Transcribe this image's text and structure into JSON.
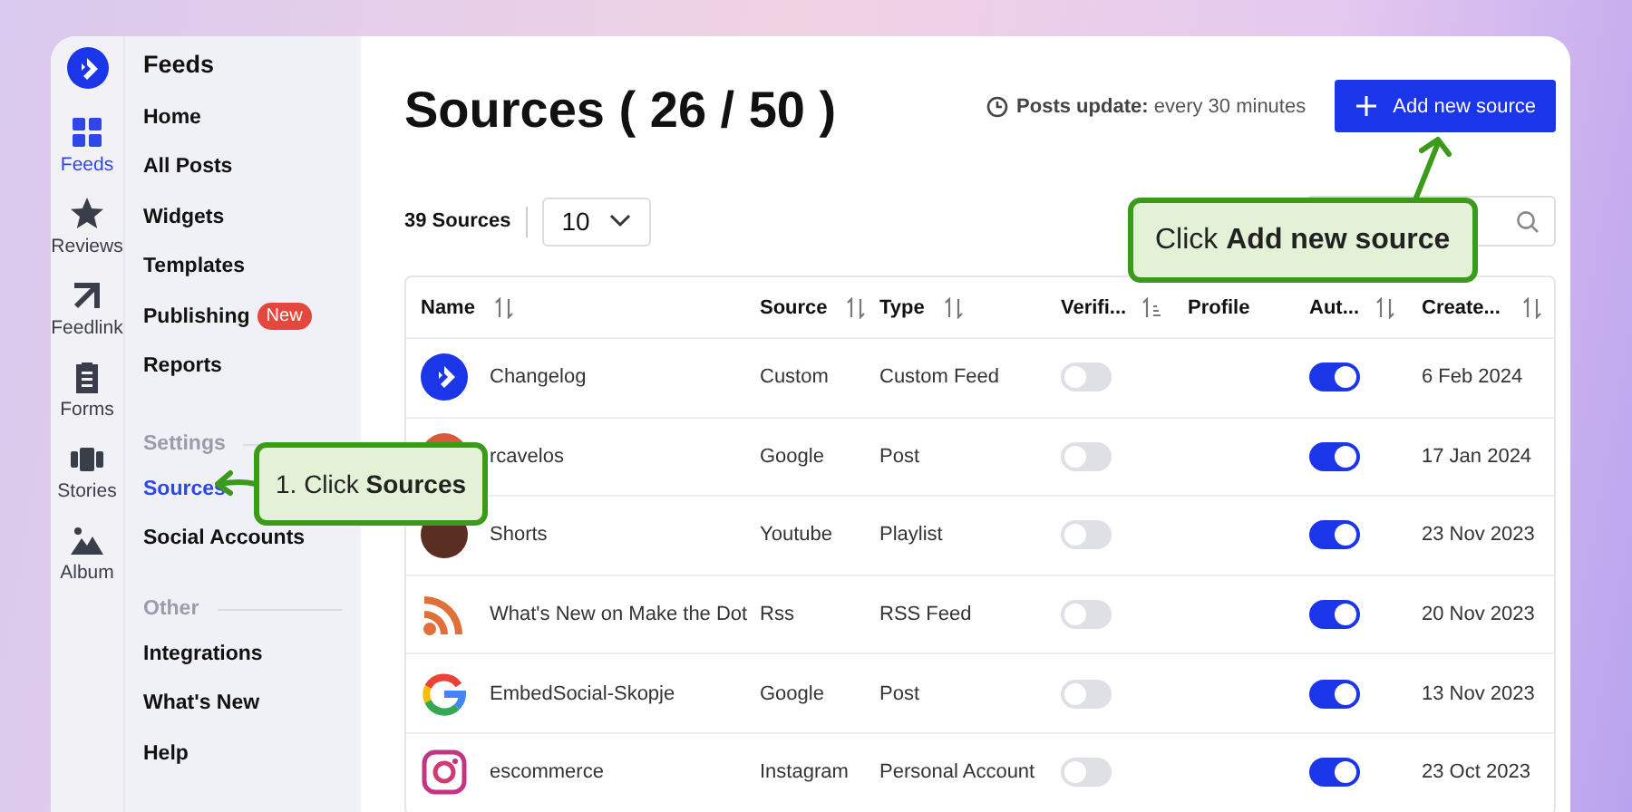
{
  "rail": [
    {
      "label": "Feeds",
      "kind": "grid",
      "selected": true
    },
    {
      "label": "Reviews",
      "kind": "star",
      "selected": false
    },
    {
      "label": "Feedlink",
      "kind": "arrow",
      "selected": false
    },
    {
      "label": "Forms",
      "kind": "clipboard",
      "selected": false
    },
    {
      "label": "Stories",
      "kind": "stories",
      "selected": false
    },
    {
      "label": "Album",
      "kind": "mountain",
      "selected": false
    }
  ],
  "sidebar": {
    "title": "Feeds",
    "sections": [
      {
        "items": [
          {
            "label": "Home",
            "selected": false
          },
          {
            "label": "All Posts",
            "selected": false
          },
          {
            "label": "Widgets",
            "selected": false
          },
          {
            "label": "Templates",
            "selected": false
          },
          {
            "label": "Publishing",
            "badge": "New",
            "selected": false
          },
          {
            "label": "Reports",
            "selected": false
          }
        ]
      },
      {
        "heading": "Settings",
        "items": [
          {
            "label": "Sources",
            "selected": true
          },
          {
            "label": "Social Accounts",
            "selected": false
          }
        ]
      },
      {
        "heading": "Other",
        "items": [
          {
            "label": "Integrations",
            "selected": false
          },
          {
            "label": "What's New",
            "selected": false
          },
          {
            "label": "Help",
            "selected": false
          }
        ]
      }
    ]
  },
  "page": {
    "title": "Sources ( 26 / 50 )",
    "update_label": "Posts update:",
    "update_value": "every 30 minutes",
    "add_button": "Add new source",
    "count": "39 Sources",
    "page_size": "10"
  },
  "table": {
    "columns": [
      {
        "label": "Name",
        "kind": "both"
      },
      {
        "label": "Source",
        "kind": "both"
      },
      {
        "label": "Type",
        "kind": "both"
      },
      {
        "label": "Verifi...",
        "kind": "asc"
      },
      {
        "label": "Profile",
        "kind": "none"
      },
      {
        "label": "Aut...",
        "kind": "both"
      },
      {
        "label": "Create...",
        "kind": "both"
      }
    ],
    "rows": [
      {
        "kind": "logo",
        "name": "Changelog",
        "source": "Custom",
        "type": "Custom Feed",
        "verified": false,
        "auto": true,
        "created": "6 Feb 2024"
      },
      {
        "kind": "photo-red",
        "name": "rcavelos",
        "source": "Google",
        "type": "Post",
        "verified": false,
        "auto": true,
        "created": "17 Jan 2024"
      },
      {
        "kind": "photo-dark",
        "name": "Shorts",
        "source": "Youtube",
        "type": "Playlist",
        "verified": false,
        "auto": true,
        "created": "23 Nov 2023"
      },
      {
        "kind": "rss",
        "name": "What's New on Make the Dot",
        "source": "Rss",
        "type": "RSS Feed",
        "verified": false,
        "auto": true,
        "created": "20 Nov 2023"
      },
      {
        "kind": "google",
        "name": "EmbedSocial-Skopje",
        "source": "Google",
        "type": "Post",
        "verified": false,
        "auto": true,
        "created": "13 Nov 2023"
      },
      {
        "kind": "instagram",
        "name": "escommerce",
        "source": "Instagram",
        "type": "Personal Account",
        "verified": false,
        "auto": true,
        "created": "23 Oct 2023"
      }
    ]
  },
  "callouts": [
    {
      "kind": "sidebar",
      "text": "1. Click **Sources**"
    },
    {
      "kind": "button",
      "text": "Click **Add new source**"
    }
  ]
}
